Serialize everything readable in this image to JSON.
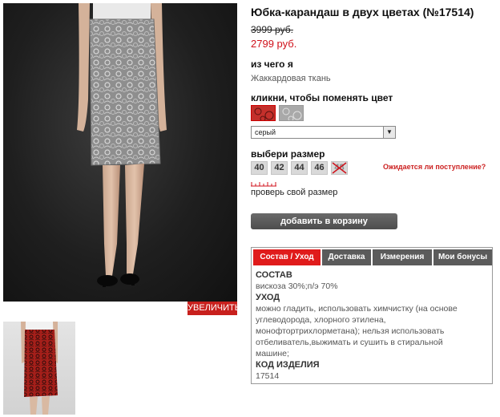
{
  "product": {
    "title": "Юбка-карандаш в двух цветах (№17514)",
    "old_price": "3999 руб.",
    "new_price": "2799 руб."
  },
  "gallery": {
    "zoom_label": "УВЕЛИЧИТЬ",
    "main_photo_icon": "skirt-photo-grey",
    "thumbnail_icon": "skirt-photo-red"
  },
  "material": {
    "heading": "из чего я",
    "value": "Жаккардовая ткань"
  },
  "color": {
    "heading": "кликни, чтобы поменять цвет",
    "swatches": [
      "red",
      "grey"
    ],
    "selected": "серый"
  },
  "size": {
    "heading": "выбери размер",
    "options": [
      "40",
      "42",
      "44",
      "46",
      "48"
    ],
    "unavailable": "48",
    "expected_link": "Ожидается ли поступление?",
    "check_link": "проверь свой размер"
  },
  "cart": {
    "button_label": "добавить в корзину"
  },
  "tabs": {
    "items": [
      "Состав / Уход",
      "Доставка",
      "Измерения",
      "Мои бонусы"
    ],
    "active": "Состав / Уход"
  },
  "details": {
    "composition_heading": "СОСТАВ",
    "composition": "вискоза 30%;п/э 70%",
    "care_heading": "УХОД",
    "care_lines": [
      "можно гладить, использовать химчистку (на основе",
      "углеводорода, хлорного этилена,",
      "монофтортрихлорметана); нельзя использовать",
      "отбеливатель,выжимать и сушить в стиральной",
      "машине;"
    ],
    "code_heading": "КОД ИЗДЕЛИЯ",
    "code": "17514"
  },
  "colors": {
    "accent_red": "#e01b1b",
    "price_red": "#d0121b",
    "button_grey": "#5b5b5b"
  }
}
